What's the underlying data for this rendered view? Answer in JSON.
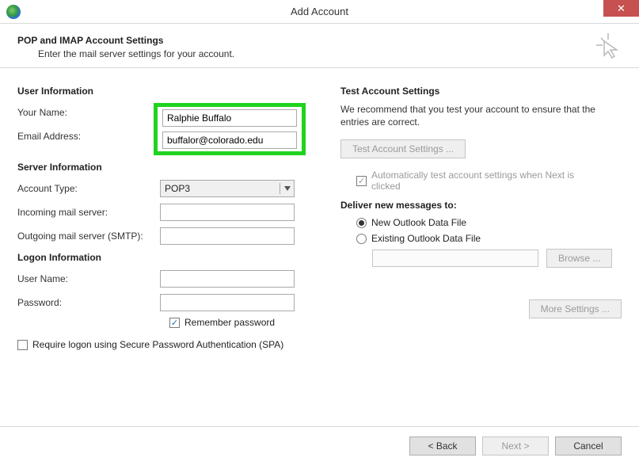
{
  "window": {
    "title": "Add Account",
    "close_glyph": "✕"
  },
  "header": {
    "title": "POP and IMAP Account Settings",
    "subtitle": "Enter the mail server settings for your account."
  },
  "left": {
    "user_info_title": "User Information",
    "your_name_label": "Your Name:",
    "your_name_value": "Ralphie Buffalo",
    "email_label": "Email Address:",
    "email_value": "buffalor@colorado.edu",
    "server_info_title": "Server Information",
    "account_type_label": "Account Type:",
    "account_type_value": "POP3",
    "incoming_label": "Incoming mail server:",
    "incoming_value": "",
    "outgoing_label": "Outgoing mail server (SMTP):",
    "outgoing_value": "",
    "logon_info_title": "Logon Information",
    "user_name_label": "User Name:",
    "user_name_value": "",
    "password_label": "Password:",
    "password_value": "",
    "remember_label": "Remember password",
    "remember_checked": true,
    "spa_label": "Require logon using Secure Password Authentication (SPA)",
    "spa_checked": false
  },
  "right": {
    "test_title": "Test Account Settings",
    "test_para": "We recommend that you test your account to ensure that the entries are correct.",
    "test_button": "Test Account Settings ...",
    "auto_test_label": "Automatically test account settings when Next is clicked",
    "auto_test_checked": true,
    "deliver_title": "Deliver new messages to:",
    "radio_new": "New Outlook Data File",
    "radio_existing": "Existing Outlook Data File",
    "radio_selected": "new",
    "browse_label": "Browse ...",
    "more_settings": "More Settings ..."
  },
  "footer": {
    "back": "<  Back",
    "next": "Next  >",
    "cancel": "Cancel"
  }
}
